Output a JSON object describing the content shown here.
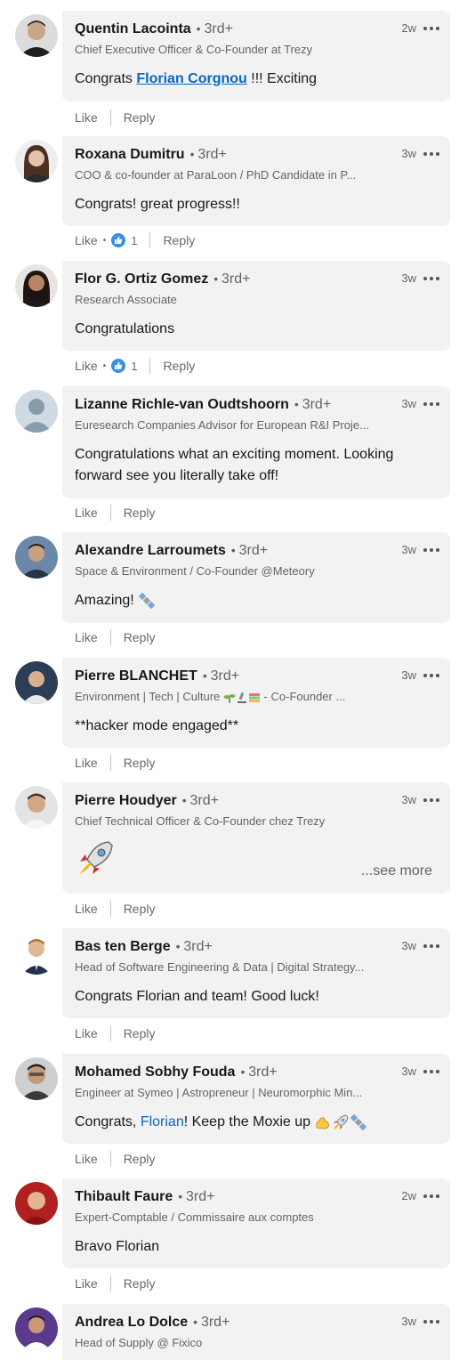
{
  "comments": [
    {
      "name": "Quentin Lacointa",
      "degree": "3rd+",
      "headline": "Chief Executive Officer & Co-Founder at Trezy",
      "time": "2w",
      "text_before": "Congrats ",
      "mention": "Florian Corgnou",
      "text_after": " !!! Exciting",
      "like": "Like",
      "reply": "Reply"
    },
    {
      "name": "Roxana Dumitru",
      "degree": "3rd+",
      "headline": "COO & co-founder at ParaLoon / PhD Candidate in P...",
      "time": "3w",
      "text": "Congrats! great progress!!",
      "like": "Like",
      "reply": "Reply",
      "reactions": "1"
    },
    {
      "name": "Flor G. Ortiz Gomez",
      "degree": "3rd+",
      "headline": "Research Associate",
      "time": "3w",
      "text": "Congratulations",
      "like": "Like",
      "reply": "Reply",
      "reactions": "1"
    },
    {
      "name": "Lizanne Richle-van Oudtshoorn",
      "degree": "3rd+",
      "headline": "Euresearch Companies Advisor for European R&I Proje...",
      "time": "3w",
      "text": "Congratulations what an exciting moment. Looking forward see you literally take off!",
      "like": "Like",
      "reply": "Reply"
    },
    {
      "name": "Alexandre Larroumets",
      "degree": "3rd+",
      "headline": "Space & Environment / Co-Founder @Meteory",
      "time": "3w",
      "text": "Amazing! ",
      "emoji": "satellite",
      "like": "Like",
      "reply": "Reply"
    },
    {
      "name": "Pierre BLANCHET",
      "degree": "3rd+",
      "headline_before": "Environment | Tech | Culture ",
      "headline_after": " - Co-Founder ...",
      "time": "3w",
      "text": "**hacker mode engaged**",
      "like": "Like",
      "reply": "Reply"
    },
    {
      "name": "Pierre Houdyer",
      "degree": "3rd+",
      "headline": "Chief Technical Officer & Co-Founder chez Trezy",
      "time": "3w",
      "emoji": "rocket",
      "see_more": "...see more",
      "like": "Like",
      "reply": "Reply"
    },
    {
      "name": "Bas ten Berge",
      "degree": "3rd+",
      "headline": "Head of Software Engineering & Data | Digital Strategy...",
      "time": "3w",
      "text": "Congrats Florian and team! Good luck!",
      "like": "Like",
      "reply": "Reply"
    },
    {
      "name": "Mohamed Sobhy Fouda",
      "degree": "3rd+",
      "headline": "Engineer at Symeo | Astropreneur | Neuromorphic Min...",
      "time": "3w",
      "text_before": "Congrats, ",
      "mention": "Florian",
      "text_after": "! Keep the Moxie up ",
      "like": "Like",
      "reply": "Reply"
    },
    {
      "name": "Thibault Faure",
      "degree": "3rd+",
      "headline": "Expert-Comptable / Commissaire aux comptes",
      "time": "2w",
      "text": "Bravo Florian",
      "like": "Like",
      "reply": "Reply"
    },
    {
      "name": "Andrea Lo Dolce",
      "degree": "3rd+",
      "headline": "Head of Supply @ Fixico",
      "time": "3w"
    }
  ],
  "colors": {
    "bubble": "#f2f2f2",
    "link": "#0a66c2",
    "muted": "#666666"
  }
}
